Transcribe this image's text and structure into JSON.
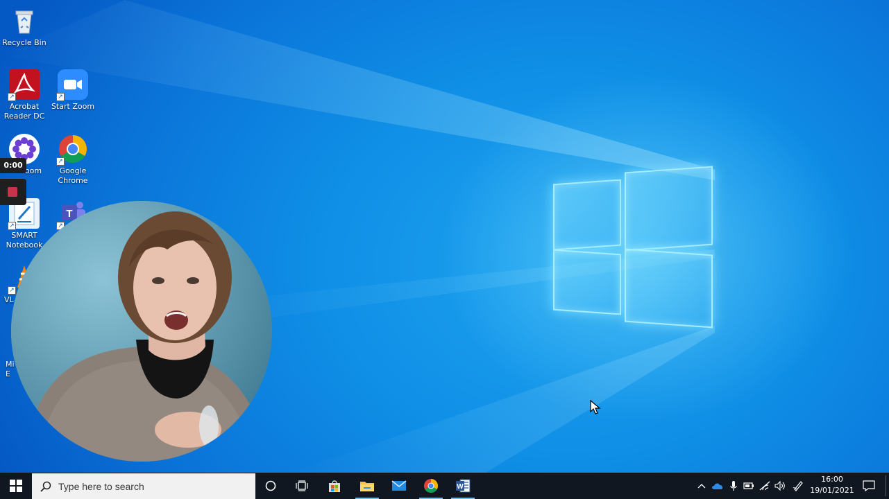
{
  "desktop": {
    "icons": [
      {
        "label": "Recycle Bin",
        "icon": "recycle-bin-icon"
      },
      {
        "label": "Acrobat Reader DC",
        "icon": "acrobat-reader-icon"
      },
      {
        "label": "Start Zoom",
        "icon": "zoom-icon"
      },
      {
        "label": "oom",
        "icon": "flower-app-icon"
      },
      {
        "label": "Google Chrome",
        "icon": "chrome-icon"
      },
      {
        "label": "SMART Notebook",
        "icon": "smart-notebook-icon"
      },
      {
        "label": "",
        "icon": "teams-icon"
      },
      {
        "label": "VL",
        "icon": "vlc-icon"
      },
      {
        "label": "Mi E",
        "icon": "edge-icon"
      }
    ]
  },
  "recording": {
    "timer": "0:00"
  },
  "taskbar": {
    "start_icon": "windows-start-icon",
    "search_placeholder": "Type here to search",
    "pinned": [
      {
        "name": "cortana",
        "icon": "cortana-circle-icon"
      },
      {
        "name": "task-view",
        "icon": "task-view-icon"
      },
      {
        "name": "store",
        "icon": "store-icon"
      },
      {
        "name": "file-explorer",
        "icon": "folder-icon"
      },
      {
        "name": "mail",
        "icon": "mail-icon"
      },
      {
        "name": "chrome",
        "icon": "chrome-icon"
      },
      {
        "name": "word",
        "icon": "word-icon"
      }
    ],
    "tray": [
      "chevron-up-icon",
      "onedrive-icon",
      "microphone-icon",
      "battery-icon",
      "wifi-icon",
      "volume-icon",
      "pen-icon"
    ],
    "time": "16:00",
    "date": "19/01/2021"
  },
  "colors": {
    "taskbar": "#101721",
    "accent": "#76b9ed",
    "desktop": "#0f8fe6"
  }
}
